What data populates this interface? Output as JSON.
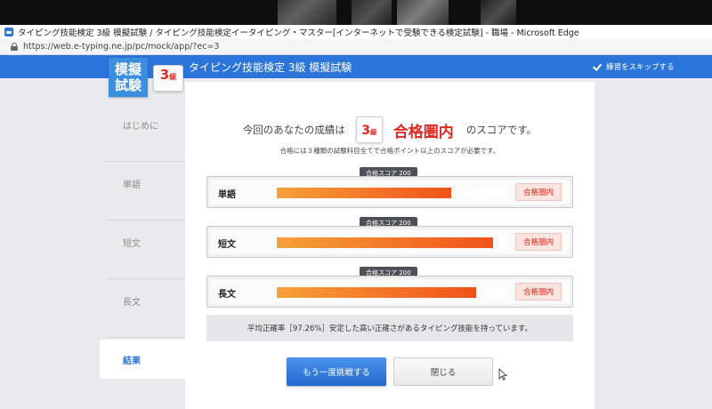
{
  "window": {
    "title": "タイピング技能検定 3級 模擬試験 / タイピング技能検定イータイピング・マスター[インターネットで受験できる検定試験] - 職場 - Microsoft Edge",
    "url": "https://web.e-typing.ne.jp/pc/mock/app/?ec=3"
  },
  "header": {
    "logo_line1": "模擬",
    "logo_line2": "試験",
    "grade_num": "3",
    "grade_kyu": "級",
    "title": "タイピング技能検定 3級 模擬試験",
    "skip_label": "練習をスキップする"
  },
  "sidebar": {
    "items": [
      {
        "label": "はじめに"
      },
      {
        "label": "単語"
      },
      {
        "label": "短文"
      },
      {
        "label": "長文"
      },
      {
        "label": "結果"
      }
    ]
  },
  "result": {
    "prefix": "今回のあなたの成績は",
    "grade_num": "3",
    "grade_kyu": "級",
    "status": "合格圏内",
    "suffix": "のスコアです。",
    "note": "合格には３種類の試験科目全てで合格ポイント以上のスコアが必要です。"
  },
  "scores": [
    {
      "label": "単語",
      "tooltip": "合格スコア 200",
      "fill": 0.76,
      "badge": "合格圏内"
    },
    {
      "label": "短文",
      "tooltip": "合格スコア 200",
      "fill": 0.94,
      "badge": "合格圏内"
    },
    {
      "label": "長文",
      "tooltip": "合格スコア 200",
      "fill": 0.87,
      "badge": "合格圏内"
    }
  ],
  "summary": "平均正確率［97.26%］安定した高い正確さがあるタイピング技能を持っています。",
  "buttons": {
    "retry": "もう一度挑戦する",
    "close": "閉じる"
  },
  "colors": {
    "brand_blue": "#2b74d9",
    "pass_red": "#e1271f",
    "bar_start": "#f6a13a",
    "bar_end": "#f0521a"
  }
}
